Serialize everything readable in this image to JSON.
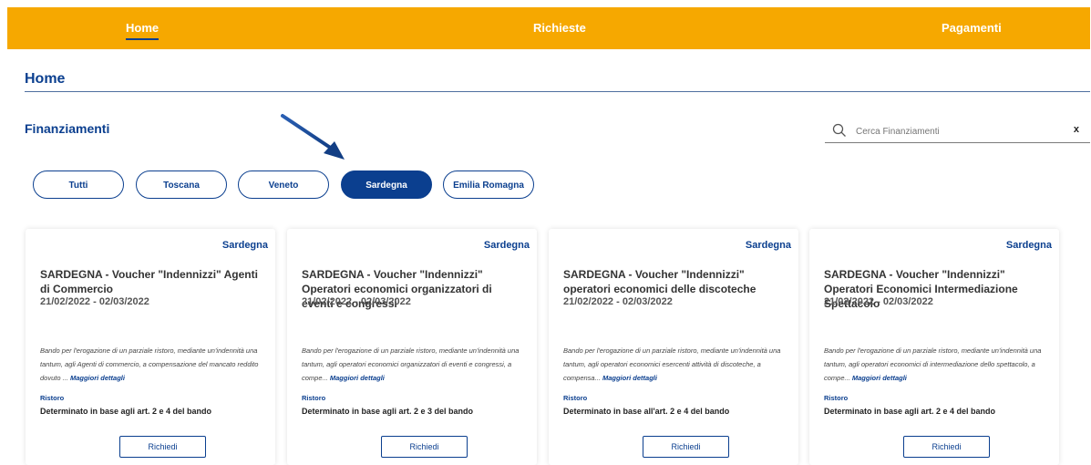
{
  "nav": {
    "home": "Home",
    "requests": "Richieste",
    "payments": "Pagamenti"
  },
  "page_title": "Home",
  "section_title": "Finanziamenti",
  "search": {
    "placeholder": "Cerca Finanziamenti",
    "clear": "x"
  },
  "filters": [
    "Tutti",
    "Toscana",
    "Veneto",
    "Sardegna",
    "Emilia Romagna"
  ],
  "active_filter": "Sardegna",
  "cards": [
    {
      "region": "Sardegna",
      "title": "SARDEGNA - Voucher \"Indennizzi\" Agenti di Commercio",
      "dates": "21/02/2022 - 02/03/2022",
      "description": "Bando per l'erogazione di un parziale ristoro, mediante un'indennità una tantum, agli Agenti di commercio, a compensazione del mancato reddito dovuto ...",
      "more": "Maggiori dettagli",
      "type": "Ristoro",
      "amount": "Determinato in base agli art. 2 e 4 del bando",
      "button": "Richiedi"
    },
    {
      "region": "Sardegna",
      "title": "SARDEGNA - Voucher \"Indennizzi\" Operatori economici organizzatori di eventi e congressi",
      "dates": "21/02/2022 - 02/03/2022",
      "description": "Bando per l'erogazione di un parziale ristoro, mediante un'indennità una tantum, agli operatori economici organizzatori di eventi e congressi, a compe...",
      "more": "Maggiori dettagli",
      "type": "Ristoro",
      "amount": "Determinato in base agli art. 2 e 3 del bando",
      "button": "Richiedi"
    },
    {
      "region": "Sardegna",
      "title": "SARDEGNA - Voucher \"Indennizzi\" operatori economici delle discoteche",
      "dates": "21/02/2022 - 02/03/2022",
      "description": "Bando per l'erogazione di un parziale ristoro, mediante un'indennità una tantum, agli operatori economici esercenti attività di discoteche, a compensa...",
      "more": "Maggiori dettagli",
      "type": "Ristoro",
      "amount": "Determinato in base all'art. 2 e 4 del bando",
      "button": "Richiedi"
    },
    {
      "region": "Sardegna",
      "title": "SARDEGNA - Voucher \"Indennizzi\" Operatori Economici Intermediazione Spettacolo",
      "dates": "21/02/2022 - 02/03/2022",
      "description": "Bando per l'erogazione di un parziale ristoro, mediante un'indennità una tantum, agli operatori economici di intermediazione dello spettacolo, a compe...",
      "more": "Maggiori dettagli",
      "type": "Ristoro",
      "amount": "Determinato in base agli art. 2 e 4 del bando",
      "button": "Richiedi"
    }
  ],
  "colors": {
    "topbar": "#f6a800",
    "primary": "#0b3f8f"
  }
}
